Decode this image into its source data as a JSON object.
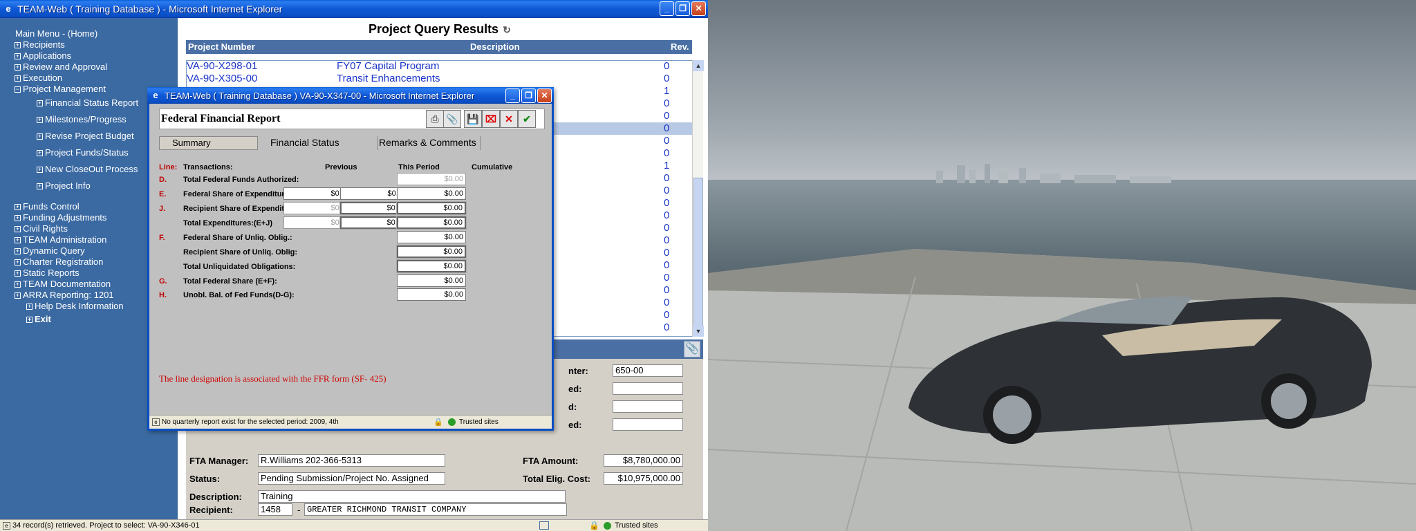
{
  "main_window": {
    "title": "TEAM-Web ( Training Database ) - Microsoft Internet Explorer",
    "status_text": "34 record(s) retrieved. Project to select: VA-90-X346-01",
    "zone": "Trusted sites"
  },
  "nav": {
    "home": "Main Menu - (Home)",
    "items_top": [
      "Recipients",
      "Applications",
      "Review and Approval",
      "Execution"
    ],
    "project_management": "Project Management",
    "project_management_sub": [
      "Financial Status Report",
      "Milestones/Progress",
      "Revise Project Budget",
      "Project Funds/Status",
      "New CloseOut Process",
      "Project Info"
    ],
    "items_bottom": [
      "Funds Control",
      "Funding Adjustments",
      "Civil Rights",
      "TEAM Administration",
      "Dynamic Query",
      "Charter Registration",
      "Static Reports",
      "TEAM Documentation",
      "ARRA Reporting: 1201"
    ],
    "help_desk": "Help Desk Information",
    "exit": "Exit"
  },
  "results": {
    "title": "Project Query Results",
    "headers": {
      "project_number": "Project Number",
      "description": "Description",
      "rev": "Rev."
    },
    "rows": [
      {
        "pn": "VA-90-X298-01",
        "desc": "FY07 Capital Program",
        "rev": "0"
      },
      {
        "pn": "VA-90-X305-00",
        "desc": "Transit Enhancements",
        "rev": "0"
      }
    ],
    "rev_values": [
      "0",
      "0",
      "1",
      "0",
      "0",
      "0",
      "0",
      "0",
      "1",
      "0",
      "0",
      "0",
      "0",
      "0",
      "0",
      "0",
      "0",
      "0",
      "0",
      "0",
      "0",
      "0"
    ]
  },
  "detail": {
    "cost_center_label": "nter:",
    "cost_center_value": "650-00",
    "label2": "ed:",
    "label3": "d:",
    "label4": "ed:",
    "fta_manager_label": "FTA Manager:",
    "fta_manager_value": "R.Williams 202-366-5313",
    "fta_amount_label": "FTA Amount:",
    "fta_amount_value": "$8,780,000.00",
    "status_label": "Status:",
    "status_value": "Pending Submission/Project No. Assigned",
    "total_elig_label": "Total Elig. Cost:",
    "total_elig_value": "$10,975,000.00",
    "description_label": "Description:",
    "description_value": "Training",
    "recipient_label": "Recipient:",
    "recipient_id": "1458",
    "recipient_sep": "-",
    "recipient_name": "GREATER RICHMOND TRANSIT COMPANY"
  },
  "popup": {
    "title": "TEAM-Web ( Training Database ) VA-90-X347-00 - Microsoft Internet Explorer",
    "form_title": "Federal Financial Report",
    "tabs": {
      "summary": "Summary",
      "financial": "Financial Status",
      "remarks": "Remarks & Comments"
    },
    "columns": {
      "line": "Line:",
      "transactions": "Transactions:",
      "previous": "Previous",
      "this_period": "This Period",
      "cumulative": "Cumulative"
    },
    "rows": [
      {
        "line": "D.",
        "label": "Total Federal Funds Authorized:",
        "cumulative": "$0.00"
      },
      {
        "line": "E.",
        "label": "Federal Share of Expenditures:",
        "previous": "$0.00",
        "this_period": "$0.00",
        "cumulative": "$0.00"
      },
      {
        "line": "J.",
        "label": "Recipient Share of Expenditures:",
        "previous": "$0.00",
        "this_period": "$0.00",
        "cumulative": "$0.00"
      },
      {
        "line": "",
        "label": "Total Expenditures:(E+J)",
        "previous": "$0.00",
        "this_period": "$0.00",
        "cumulative": "$0.00"
      },
      {
        "line": "F.",
        "label": "Federal Share of Unliq. Oblig.:",
        "cumulative": "$0.00"
      },
      {
        "line": "",
        "label": "Recipient Share of Unliq. Oblig:",
        "cumulative": "$0.00"
      },
      {
        "line": "",
        "label": "Total Unliquidated Obligations:",
        "cumulative": "$0.00"
      },
      {
        "line": "G.",
        "label": "Total Federal Share (E+F):",
        "cumulative": "$0.00"
      },
      {
        "line": "H.",
        "label": "Unobl. Bal. of Fed Funds(D-G):",
        "cumulative": "$0.00"
      }
    ],
    "note": "The line designation is associated with the FFR form (SF- 425)",
    "status_text": "No quarterly report exist for the selected period: 2009, 4th",
    "zone": "Trusted sites",
    "toolbar": [
      "print-icon",
      "attach-icon",
      "save-icon",
      "delete-icon",
      "cancel-icon",
      "ok-icon"
    ]
  },
  "colors": {
    "nav_bg": "#3b6aa2",
    "header_bg": "#4a6fa5",
    "link": "#1a34c8",
    "line_red": "#c00000",
    "xp_title": "#0a4ec4"
  }
}
